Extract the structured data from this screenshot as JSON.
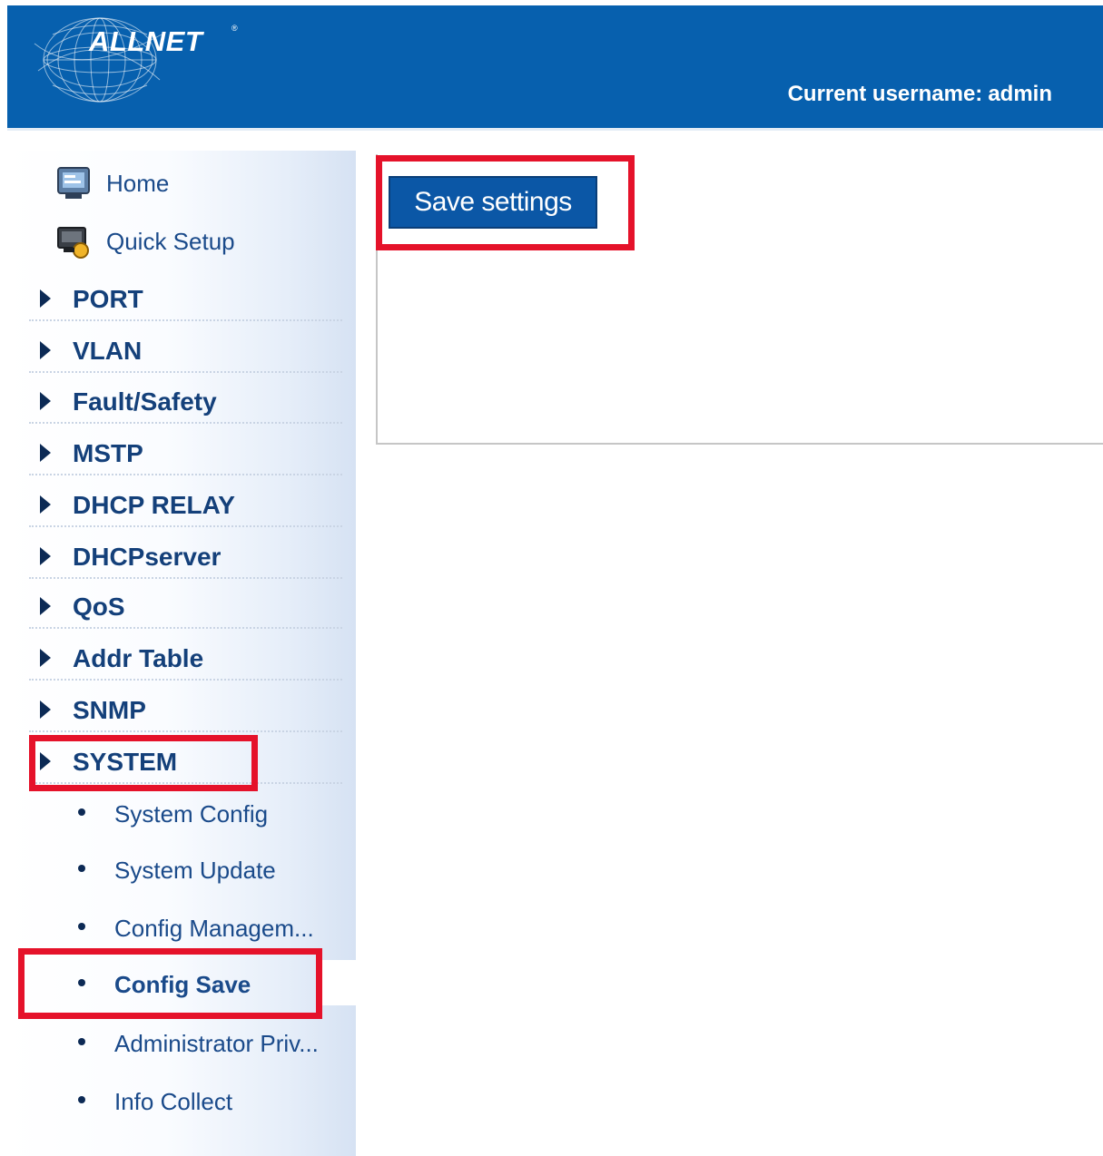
{
  "header": {
    "logo": "ALLNET",
    "logo_mark": "®",
    "username_label": "Current username:",
    "username": "admin"
  },
  "sidebar": {
    "top_items": [
      {
        "label": "Home",
        "icon": "home-computer-icon"
      },
      {
        "label": "Quick Setup",
        "icon": "quick-setup-icon"
      }
    ],
    "menu": [
      {
        "label": "PORT"
      },
      {
        "label": "VLAN"
      },
      {
        "label": "Fault/Safety"
      },
      {
        "label": "MSTP"
      },
      {
        "label": "DHCP RELAY"
      },
      {
        "label": "DHCPserver"
      },
      {
        "label": "QoS"
      },
      {
        "label": "Addr Table"
      },
      {
        "label": "SNMP"
      },
      {
        "label": "SYSTEM",
        "expanded": true
      }
    ],
    "system_submenu": [
      {
        "label": "System Config"
      },
      {
        "label": "System Update"
      },
      {
        "label": "Config Managem..."
      },
      {
        "label": "Config Save",
        "active": true
      },
      {
        "label": "Administrator Priv..."
      },
      {
        "label": "Info Collect"
      }
    ]
  },
  "content": {
    "save_button_label": "Save settings"
  },
  "colors": {
    "header_bg": "#0760ae",
    "button_bg": "#0b57a6",
    "highlight": "#e5122a",
    "menu_text": "#14407a"
  }
}
